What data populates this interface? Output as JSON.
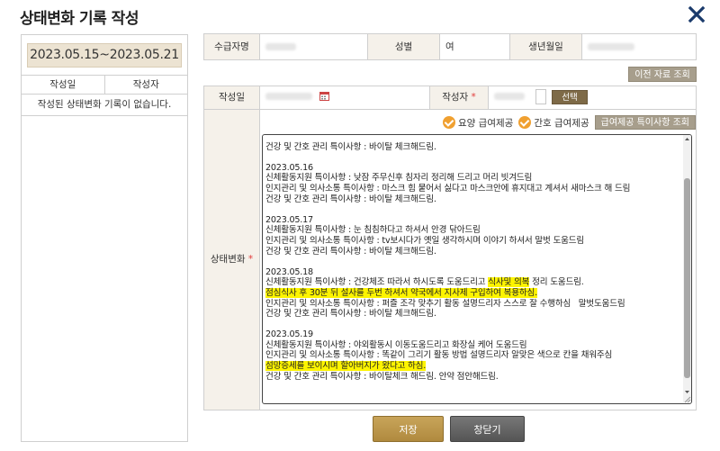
{
  "window": {
    "title": "상태변화 기록 작성"
  },
  "left_panel": {
    "date_range": "2023.05.15~2023.05.21",
    "col_date": "작성일",
    "col_author": "작성자",
    "empty_message": "작성된 상태변화 기록이 없습니다."
  },
  "info": {
    "recipient_label": "수급자명",
    "gender_label": "성별",
    "gender_value": "여",
    "birth_label": "생년월일"
  },
  "buttons": {
    "prev_records": "이전 자료 조회",
    "select": "선택",
    "special_notes": "급여제공 특이사항 조회",
    "save": "저장",
    "close": "창닫기"
  },
  "form": {
    "date_label": "작성일",
    "author_label": "작성자",
    "status_label": "상태변화",
    "required_mark": "*"
  },
  "checkboxes": [
    {
      "label": "요양 급여제공",
      "checked": true
    },
    {
      "label": "간호 급여제공",
      "checked": true
    }
  ],
  "textarea_lines": [
    {
      "text": "",
      "hl": false
    },
    {
      "text": "건강 및 간호 관리 특이사항 : 바이탈 체크해드림.",
      "hl": false
    },
    {
      "text": "",
      "hl": false
    },
    {
      "text": "2023.05.16",
      "hl": false
    },
    {
      "text": "신체활동지원 특이사항 : 낮잠 주무신후 침자리 정리해 드리고 머리 빗겨드림",
      "hl": false
    },
    {
      "text": "인지관리 및 의사소통 특이사항 : 마스크 힘 뭍어서 싫다고 마스크안에 휴지대고 계셔서 새마스크 해 드림",
      "hl": false
    },
    {
      "text": "건강 및 간호 관리 특이사항 : 바이탈 체크해드림.",
      "hl": false
    },
    {
      "text": "",
      "hl": false
    },
    {
      "text": "2023.05.17",
      "hl": false
    },
    {
      "text": "신체활동지원 특이사항 : 눈 침침하다고 하셔서 안경 닦아드림",
      "hl": false
    },
    {
      "text": "인지관리 및 의사소통 특이사항 : tv보시다가 옛일 생각하시며 이야기 하셔서 말벗 도움드림",
      "hl": false
    },
    {
      "text": "건강 및 간호 관리 특이사항 : 바이탈 체크해드림.",
      "hl": false
    },
    {
      "text": "",
      "hl": false
    },
    {
      "text": "2023.05.18",
      "hl": false
    },
    {
      "text": "신체활동지원 특이사항 : 건강체조 따라서 하시도록 도움드리고 식사및 의복 정리 도움드림.",
      "hl": false,
      "hl_part": "식사및 의복"
    },
    {
      "text": "점심식사 후 30분 뒤 설사를 두번 하셔서 약국에서 지사제 구입하여 복용하심.",
      "hl": true
    },
    {
      "text": "인지관리 및 의사소통 특이사항 : 퍼즐 조각 맞추기 활동 설명드리자 스스로 잘 수행하심   말벗도움드림",
      "hl": false
    },
    {
      "text": "건강 및 간호 관리 특이사항 : 바이탈 체크해드림.",
      "hl": false
    },
    {
      "text": "",
      "hl": false
    },
    {
      "text": "2023.05.19",
      "hl": false
    },
    {
      "text": "신체활동지원 특이사항 : 야외활동시 이동도움드리고 화장실 케어 도움드림",
      "hl": false
    },
    {
      "text": "인지관리 및 의사소통 특이사항 : 똑같이 그리기 활동 방법 설명드리자 알맞은 색으로 칸을 채워주심",
      "hl": false
    },
    {
      "text": "섬망증세를 보이시며 할아버지가 왔다고 하심.",
      "hl": true
    },
    {
      "text": "건강 및 간호 관리 특이사항 : 바이탈체크 해드림. 안약 점안해드림.",
      "hl": false
    }
  ],
  "colors": {
    "accent_brown": "#7e6a47",
    "label_bg": "#f5f1ea",
    "highlight": "#fdf400",
    "checkbox": "#f0a030"
  }
}
